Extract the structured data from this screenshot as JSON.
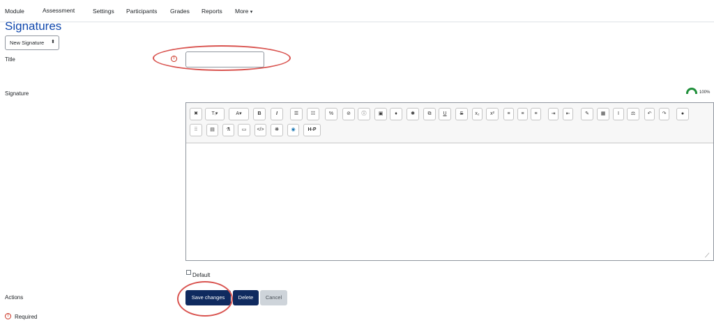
{
  "nav": {
    "items": [
      "Module",
      "Assessment",
      "Settings",
      "Participants",
      "Grades",
      "Reports",
      "More"
    ],
    "more_caret": "▾"
  },
  "page": {
    "title": "Signatures"
  },
  "select": {
    "value": "New Signature",
    "arrow": "⬍"
  },
  "form": {
    "title_label": "Title",
    "title_value": "",
    "signature_label": "Signature",
    "editor_zoom": "100%",
    "default_label": "Default",
    "actions_label": "Actions",
    "required_label": "Required"
  },
  "toolbar": {
    "row1": [
      {
        "name": "fullscreen-icon",
        "glyph": "✖"
      },
      {
        "name": "font-size-icon",
        "glyph": "Tᵢ▾"
      },
      {
        "name": "text-color-icon",
        "glyph": "A▾"
      },
      {
        "name": "bold-icon",
        "glyph": "B"
      },
      {
        "name": "italic-icon",
        "glyph": "I"
      },
      {
        "name": "unordered-list-icon",
        "glyph": "☰"
      },
      {
        "name": "ordered-list-icon",
        "glyph": "☷"
      },
      {
        "name": "link-icon",
        "glyph": "%"
      },
      {
        "name": "unlink-icon",
        "glyph": "⊘"
      },
      {
        "name": "emoji-icon",
        "glyph": "ⓘ"
      },
      {
        "name": "image-icon",
        "glyph": "▣"
      },
      {
        "name": "audio-icon",
        "glyph": "♦"
      },
      {
        "name": "media-icon",
        "glyph": "✱"
      },
      {
        "name": "manage-files-icon",
        "glyph": "⧉"
      },
      {
        "name": "underline-icon",
        "glyph": "U"
      },
      {
        "name": "strikethrough-icon",
        "glyph": "S"
      },
      {
        "name": "subscript-icon",
        "glyph": "x₂"
      },
      {
        "name": "superscript-icon",
        "glyph": "x²"
      },
      {
        "name": "align-left-icon",
        "glyph": "≡"
      },
      {
        "name": "align-center-icon",
        "glyph": "≡"
      },
      {
        "name": "align-right-icon",
        "glyph": "≡"
      },
      {
        "name": "indent-icon",
        "glyph": "⇥"
      },
      {
        "name": "outdent-icon",
        "glyph": "⇤"
      },
      {
        "name": "equation-icon",
        "glyph": "✎"
      },
      {
        "name": "table-icon",
        "glyph": "▦"
      },
      {
        "name": "clear-format-icon",
        "glyph": "I"
      },
      {
        "name": "accessibility-checker-icon",
        "glyph": "⚖"
      },
      {
        "name": "undo-icon",
        "glyph": "↶"
      },
      {
        "name": "redo-icon",
        "glyph": "↷"
      },
      {
        "name": "help-icon",
        "glyph": "●"
      }
    ],
    "row2": [
      {
        "name": "toggle-toolbar-icon",
        "glyph": "⁞⁞"
      },
      {
        "name": "calculator-icon",
        "glyph": "▤"
      },
      {
        "name": "chemistry-icon",
        "glyph": "⚗"
      },
      {
        "name": "screen-reader-icon",
        "glyph": "▭"
      },
      {
        "name": "html-icon",
        "glyph": "</>"
      },
      {
        "name": "special-chars-icon",
        "glyph": "❋"
      },
      {
        "name": "record-icon",
        "glyph": "◉"
      },
      {
        "name": "h5p-icon",
        "glyph": "H-P"
      }
    ]
  },
  "buttons": {
    "save": "Save changes",
    "delete": "Delete",
    "cancel": "Cancel"
  },
  "colors": {
    "brand_title": "#0f47ad",
    "primary_button": "#0f2a5f",
    "required": "#ca3120",
    "annotation": "#d9534f",
    "gauge": "#1f8f3a"
  }
}
